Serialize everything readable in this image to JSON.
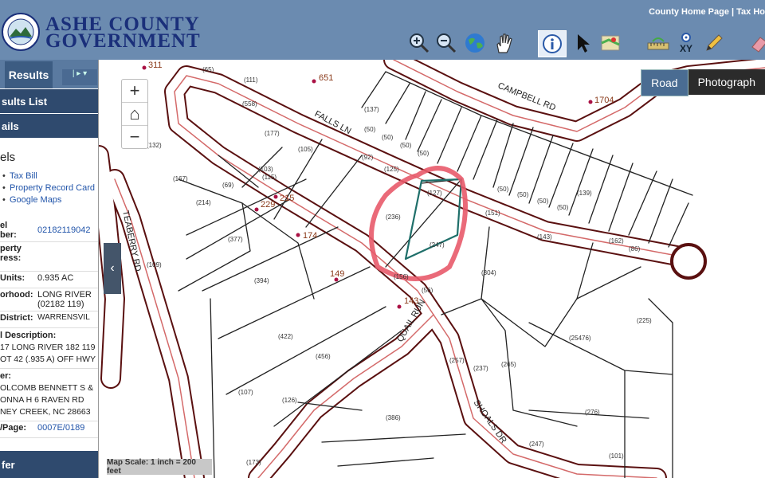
{
  "header": {
    "seal_text": "ASHE COUNTY NORTH CAROLINA",
    "brand_line1": "Ashe County",
    "brand_line2": "Government",
    "top_links": "County Home Page | Tax Ho",
    "tools": [
      "zoom-in-icon",
      "zoom-out-icon",
      "globe-icon",
      "pan-hand-icon",
      "info-icon",
      "select-arrow-icon",
      "map-layers-icon",
      "measure-ruler-icon",
      "xy-coordinates-icon",
      "pencil-icon",
      "eraser-icon"
    ],
    "xy_label": "XY"
  },
  "sidebar": {
    "tab_results": "Results",
    "tab_more": "| ▸  ▾",
    "results_list": "sults List",
    "details": "ails",
    "parcels_title": "els",
    "links": [
      "Tax Bill",
      "Property Record Card",
      "Google Maps"
    ],
    "rows": [
      {
        "label": "el\nber:",
        "value": "02182119042",
        "link": true
      },
      {
        "label": "perty\nress:",
        "value": "",
        "link": false
      },
      {
        "label": "Units:",
        "value": "0.935 AC",
        "link": false
      },
      {
        "label": "orhood:",
        "value": "LONG RIVER (02182 119)",
        "link": false
      },
      {
        "label": "District:",
        "value": "WARRENSVIL",
        "link": false
      }
    ],
    "legal_label": "l Description:",
    "legal_value": "17 LONG RIVER 182 119 OT 42 (.935 A) OFF HWY",
    "owner_label": "er:",
    "owner_value": "OLCOMB BENNETT S & ONNA H 6 RAVEN RD NEY CREEK, NC 28663",
    "page_label": "/Page:",
    "page_value": "0007E/0189",
    "bottom_section": "fer"
  },
  "map": {
    "zoom_in": "+",
    "home": "⌂",
    "zoom_out": "−",
    "basemap_road": "Road",
    "basemap_photo": "Photograph",
    "collapse": "‹",
    "scale": "Map Scale: 1 inch = 200 feet",
    "roads": [
      "FALLS LN",
      "CAMPBELL RD",
      "TEABERRY RD",
      "QUAIL RUN",
      "SHOALS DR"
    ],
    "lot_numbers": [
      "311",
      "651",
      "1704",
      "229",
      "215",
      "174",
      "149",
      "143"
    ],
    "dims": [
      "(65)",
      "(111)",
      "(558)",
      "(137)",
      "(50)",
      "(50)",
      "(50)",
      "(50)",
      "(50)",
      "(50)",
      "(50)",
      "(50)",
      "(125)",
      "(127)",
      "(236)",
      "(247)",
      "(156)",
      "(56)",
      "(304)",
      "(225)",
      "(143)",
      "(151)",
      "(394)",
      "(422)",
      "(456)",
      "(377)",
      "(214)",
      "(167)",
      "(132)",
      "(107)",
      "(126)",
      "(173)",
      "(386)",
      "(237)",
      "(247)",
      "(101)",
      "(276)",
      "(265)",
      "(257)",
      "(25476)",
      "(109)",
      "(162)",
      "(86)",
      "(115)",
      "(69)",
      "(92)",
      "(103)",
      "(177)",
      "(105)",
      "(139)"
    ]
  },
  "colors": {
    "header_bg": "#6b8bb0",
    "brand": "#1a2f7a",
    "section_bg": "#2f4a6e",
    "road_casing": "#5a1010",
    "road_center": "#d46a6a",
    "parcel_highlight": "#1f6f6a",
    "annotation_circle": "#e85a6a"
  }
}
